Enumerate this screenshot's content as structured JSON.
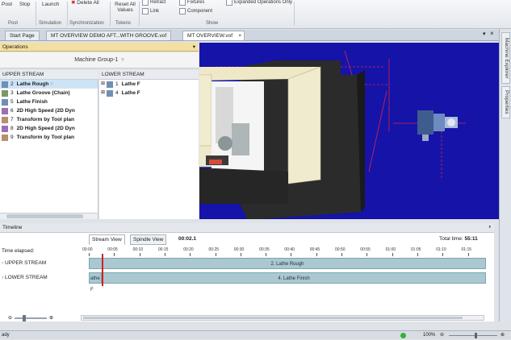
{
  "ribbon": {
    "buttons": [
      "Post",
      "Stop",
      "Launch",
      "Delete All",
      "Reset All Values"
    ],
    "groups": [
      "Post",
      "Simulation",
      "Synchronization",
      "Tokens",
      "Show"
    ],
    "checkboxes": [
      "Retract",
      "Link",
      "Fixtures",
      "Component",
      "Expanded Operations Only"
    ]
  },
  "doc_tabs": [
    "Start Page",
    "MT OVERVIEW DEMO AFT...WITH GROOVE.vof",
    "MT OVERVIEW.vof"
  ],
  "right_dock": {
    "tabs": [
      "Machine Explorer",
      "Properties"
    ]
  },
  "operations": {
    "title": "Operations",
    "machine_group": "Machine Group-1",
    "upper_header": "UPPER STREAM",
    "lower_header": "LOWER STREAM",
    "upper_items": [
      {
        "num": "2",
        "name": "Lathe Rough"
      },
      {
        "num": "3",
        "name": "Lathe Groove (Chain)"
      },
      {
        "num": "5",
        "name": "Lathe Finish"
      },
      {
        "num": "6",
        "name": "2D High Speed (2D Dyn"
      },
      {
        "num": "7",
        "name": "Transform by Tool plan"
      },
      {
        "num": "8",
        "name": "2D High Speed (2D Dyn"
      },
      {
        "num": "9",
        "name": "Transform by Tool plan"
      }
    ],
    "lower_items": [
      {
        "num": "1",
        "name": "Lathe F"
      },
      {
        "num": "4",
        "name": "Lathe F"
      }
    ]
  },
  "timeline": {
    "title": "Timeline",
    "elapsed_label": "Time elapsed:",
    "tabs": [
      "Stream View",
      "Spindle View"
    ],
    "current_time": "00:02.1",
    "total_time_label": "Total time:",
    "total_time": "55:11",
    "ticks": [
      "00:00",
      "00:05",
      "00:10",
      "00:15",
      "00:20",
      "00:25",
      "00:30",
      "00:35",
      "00:40",
      "00:45",
      "00:50",
      "00:55",
      "01:00",
      "01:05",
      "01:10",
      "01:15"
    ],
    "lanes": [
      {
        "label": "UPPER STREAM",
        "bar": "2. Lathe Rough"
      },
      {
        "label": "LOWER STREAM",
        "left_bar": "athe F",
        "bar": "4. Lathe Finish"
      }
    ]
  },
  "status": {
    "left": "ady",
    "zoom": "100%"
  },
  "colors": {
    "viewport_bg": "#1513a8",
    "ops_title_bg": "#f3dfa1",
    "lane_bar": "#a9c8d0",
    "playhead": "#d42020"
  }
}
